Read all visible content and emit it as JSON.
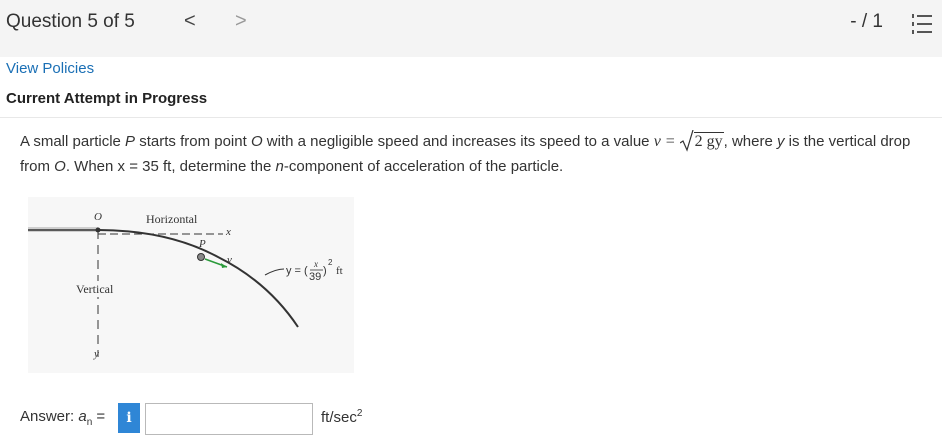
{
  "header": {
    "question_title": "Question 5 of 5",
    "prev_glyph": "<",
    "next_glyph": ">",
    "score": "- / 1",
    "list_icon": "list-icon"
  },
  "links": {
    "view_policies": "View Policies"
  },
  "attempt_label": "Current Attempt in Progress",
  "problem": {
    "part1": "A small particle ",
    "var_P": "P",
    "part2": " starts from point ",
    "var_O": "O",
    "part3": " with a negligible speed and increases its speed to a value ",
    "v_eq": "v = ",
    "radicand": "2 gy",
    "part4": ", where ",
    "var_y": "y",
    "part5": " is the vertical drop from ",
    "var_O2": "O",
    "part6": ". When x = 35 ft, determine the ",
    "var_n": "n",
    "part7": "-component of acceleration of the particle."
  },
  "figure": {
    "label_O": "O",
    "label_horizontal": "Horizontal",
    "label_x": "x",
    "label_P": "P",
    "label_v": "v",
    "label_vertical": "Vertical",
    "label_y": "y",
    "eq_prefix": "y = (",
    "eq_x": "x",
    "eq_den": "39",
    "eq_suffix": ")",
    "eq_exp": "2",
    "eq_unit": "ft"
  },
  "answer": {
    "label_prefix": "Answer: ",
    "label_var": "a",
    "label_sub": "n",
    "label_suffix": " =",
    "info_glyph": "i",
    "input_value": "",
    "unit_base": "ft/sec",
    "unit_exp": "2"
  }
}
